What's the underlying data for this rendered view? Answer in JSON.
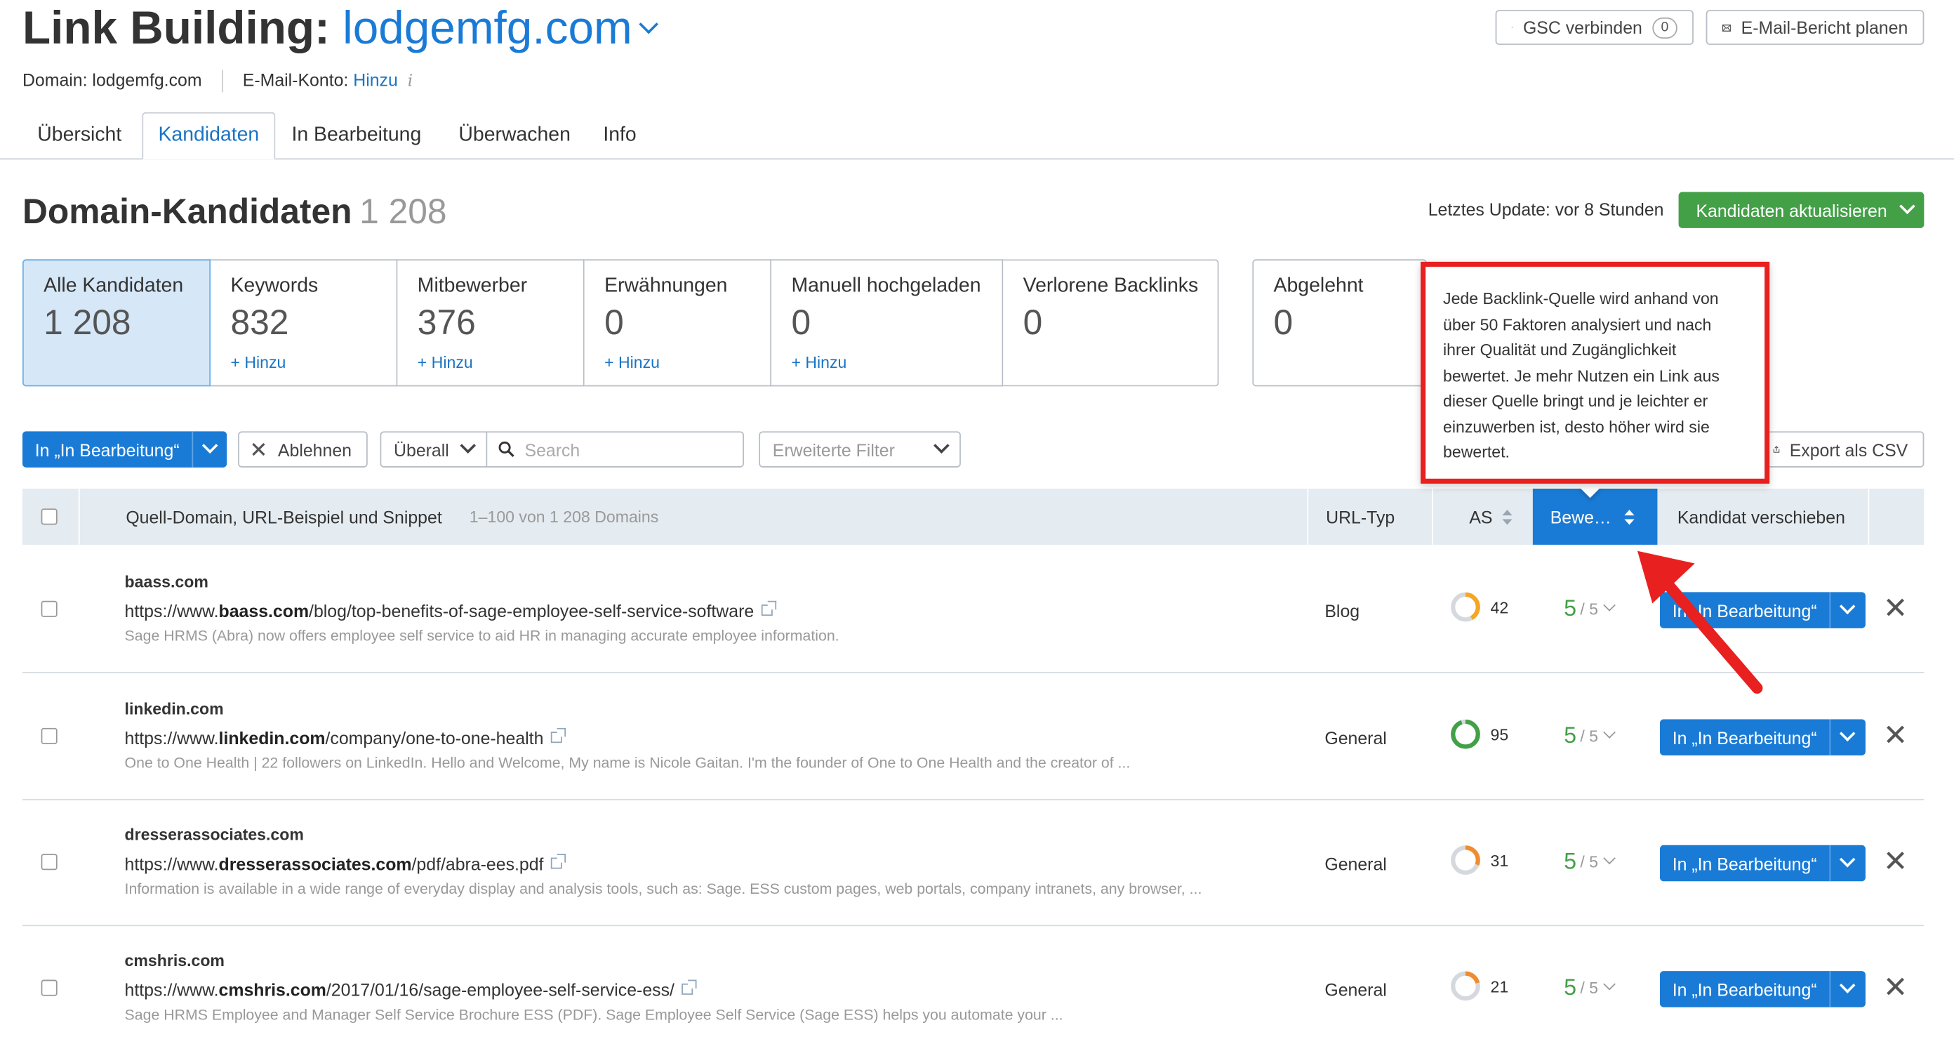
{
  "header": {
    "title_prefix": "Link Building:",
    "title_domain": "lodgemfg.com",
    "gsc_button": "GSC verbinden",
    "gsc_count": "0",
    "email_button": "E-Mail-Bericht planen",
    "domain_label": "Domain: lodgemfg.com",
    "email_account_label": "E-Mail-Konto:",
    "email_account_link": "Hinzu",
    "info_icon": "i"
  },
  "tabs": [
    {
      "label": "Übersicht"
    },
    {
      "label": "Kandidaten"
    },
    {
      "label": "In Bearbeitung"
    },
    {
      "label": "Überwachen"
    },
    {
      "label": "Info"
    }
  ],
  "section": {
    "title": "Domain-Kandidaten",
    "count": "1 208",
    "last_update": "Letztes Update: vor 8 Stunden",
    "refresh_button": "Kandidaten aktualisieren"
  },
  "cards": [
    {
      "label": "Alle Kandidaten",
      "value": "1 208",
      "add": ""
    },
    {
      "label": "Keywords",
      "value": "832",
      "add": "+ Hinzu"
    },
    {
      "label": "Mitbewerber",
      "value": "376",
      "add": "+ Hinzu"
    },
    {
      "label": "Erwähnungen",
      "value": "0",
      "add": "+ Hinzu"
    },
    {
      "label": "Manuell hochgeladen",
      "value": "0",
      "add": "+ Hinzu"
    },
    {
      "label": "Verlorene Backlinks",
      "value": "0",
      "add": ""
    },
    {
      "label": "Abgelehnt",
      "value": "0",
      "add": ""
    }
  ],
  "toolbar": {
    "move_button": "In „In Bearbeitung“",
    "reject_button": "Ablehnen",
    "scope_select": "Überall",
    "search_placeholder": "Search",
    "advanced_filter": "Erweiterte Filter",
    "export_button": "Export als CSV"
  },
  "table": {
    "col_source": "Quell-Domain, URL-Beispiel und Snippet",
    "col_range": "1–100 von 1 208 Domains",
    "col_type": "URL-Typ",
    "col_as": "AS",
    "col_rating": "Bewe…",
    "col_move": "Kandidat verschieben",
    "rows": [
      {
        "domain": "baass.com",
        "url_pre": "https://www.",
        "url_bold": "baass.com",
        "url_post": "/blog/top-benefits-of-sage-employee-self-service-software",
        "snippet": "Sage HRMS (Abra) now offers employee self service to aid HR in managing accurate employee information.",
        "type": "Blog",
        "as": 42,
        "as_color": "#f5a623",
        "rating": "5",
        "rating_max": "/ 5",
        "move": "In „In Bearbeitung“"
      },
      {
        "domain": "linkedin.com",
        "url_pre": "https://www.",
        "url_bold": "linkedin.com",
        "url_post": "/company/one-to-one-health",
        "snippet": "One to One Health | 22 followers on LinkedIn. Hello and Welcome, My name is Nicole Gaitan. I'm the founder of One to One Health and the creator of ...",
        "type": "General",
        "as": 95,
        "as_color": "#43a047",
        "rating": "5",
        "rating_max": "/ 5",
        "move": "In „In Bearbeitung“"
      },
      {
        "domain": "dresserassociates.com",
        "url_pre": "https://www.",
        "url_bold": "dresserassociates.com",
        "url_post": "/pdf/abra-ees.pdf",
        "snippet": "Information is available in a wide range of everyday display and analysis tools, such as: Sage. ESS custom pages, web portals, company intranets, any browser, ...",
        "type": "General",
        "as": 31,
        "as_color": "#f08c2e",
        "rating": "5",
        "rating_max": "/ 5",
        "move": "In „In Bearbeitung“"
      },
      {
        "domain": "cmshris.com",
        "url_pre": "https://www.",
        "url_bold": "cmshris.com",
        "url_post": "/2017/01/16/sage-employee-self-service-ess/",
        "snippet": "Sage HRMS Employee and Manager Self Service Brochure ESS (PDF). Sage Employee Self Service (Sage ESS) helps you automate your ...",
        "type": "General",
        "as": 21,
        "as_color": "#f08c2e",
        "rating": "5",
        "rating_max": "/ 5",
        "move": "In „In Bearbeitung“"
      }
    ]
  },
  "tooltip": {
    "text": "Jede Backlink-Quelle wird anhand von über 50 Faktoren analysiert und nach ihrer Qualität und Zugänglichkeit bewertet. Je mehr Nutzen ein Link aus dieser Quelle bringt und je leichter er einzuwerben ist, desto höher wird sie bewertet."
  },
  "colors": {
    "accent": "#1a7bd6",
    "green": "#43a047",
    "highlight_red": "#e8201f"
  }
}
